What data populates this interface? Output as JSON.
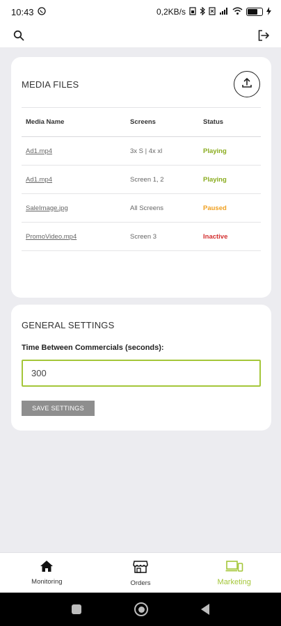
{
  "status_bar": {
    "time": "10:43",
    "net_speed": "0,2KB/s",
    "icons": [
      "whatsapp-icon",
      "bluetooth-icon",
      "sim-icon",
      "signal-icon",
      "wifi-icon",
      "battery-icon",
      "charging-icon"
    ],
    "battery_level": 0.7
  },
  "top_bar": {
    "icons": [
      "search-icon",
      "logout-icon"
    ]
  },
  "media_card": {
    "title": "MEDIA FILES",
    "upload_icon": "upload-icon",
    "columns": [
      "Media Name",
      "Screens",
      "Status"
    ],
    "rows": [
      {
        "name": "Ad1.mp4",
        "screens": "3x S | 4x xl",
        "status": "Playing",
        "color": "#8aac1f"
      },
      {
        "name": "Ad1.mp4",
        "screens": "Screen 1, 2",
        "status": "Playing",
        "color": "#8aac1f"
      },
      {
        "name": "SaleImage.jpg",
        "screens": "All Screens",
        "status": "Paused",
        "color": "#f0a020"
      },
      {
        "name": "PromoVideo.mp4",
        "screens": "Screen 3",
        "status": "Inactive",
        "color": "#d32f2f"
      }
    ]
  },
  "settings_card": {
    "title": "GENERAL SETTINGS",
    "field_label": "Time Between Commercials (seconds):",
    "field_value": "300",
    "save_label": "SAVE SETTINGS"
  },
  "bottom_nav": {
    "items": [
      {
        "label": "Monitoring",
        "icon": "home-icon",
        "active": false
      },
      {
        "label": "Orders",
        "icon": "store-icon",
        "active": false
      },
      {
        "label": "Marketing",
        "icon": "devices-icon",
        "active": true
      }
    ]
  },
  "colors": {
    "accent": "#a4c639",
    "playing": "#8aac1f",
    "paused": "#f0a020",
    "inactive": "#d32f2f"
  }
}
